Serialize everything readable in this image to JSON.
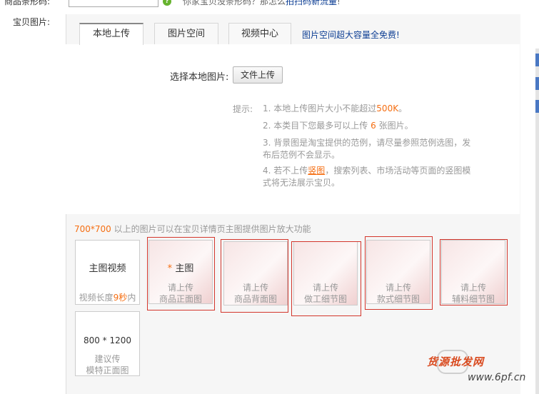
{
  "barcode": {
    "label": "商品条形码:",
    "hint_prefix": "你家宝贝没条形码？那怎么",
    "hint_link": "拍扫码新流量",
    "hint_suffix": "!"
  },
  "pictures_label": "宝贝图片:",
  "tabs": [
    {
      "label": "本地上传",
      "active": true
    },
    {
      "label": "图片空间",
      "active": false
    },
    {
      "label": "视频中心",
      "active": false
    }
  ],
  "tab_promo": "图片空间超大容量全免费!",
  "upload": {
    "choose_label": "选择本地图片:",
    "file_button": "文件上传"
  },
  "tips": {
    "label": "提示:",
    "items": [
      {
        "num": "1.",
        "pre": "本地上传图片大小不能超过",
        "hl": "500K",
        "post": "。"
      },
      {
        "num": "2.",
        "pre": "本类目下您最多可以上传 ",
        "hl": "6",
        "post": " 张图片。"
      },
      {
        "num": "3.",
        "text": "背景图是淘宝提供的范例，请尽量参照范例选图，发布后范例不会显示。"
      },
      {
        "num": "4.",
        "pre": "若不上传",
        "hl": "竖图",
        "post": "，搜索列表、市场活动等页面的竖图模式将无法展示宝贝。"
      }
    ]
  },
  "size_note": {
    "hl": "700*700",
    "text": " 以上的图片可以在宝贝详情页主图提供图片放大功能"
  },
  "slots": {
    "video": {
      "title": "主图视频",
      "sub_pre": "视频长度",
      "sub_hl": "9秒",
      "sub_post": "内"
    },
    "main": {
      "star": "*",
      "title": "主图",
      "line1": "请上传",
      "line2": "商品正面图"
    },
    "back": {
      "line1": "请上传",
      "line2": "商品背面图"
    },
    "craft": {
      "line1": "请上传",
      "line2": "做工细节图"
    },
    "style": {
      "line1": "请上传",
      "line2": "款式细节图"
    },
    "accessory": {
      "line1": "请上传",
      "line2": "辅料细节图"
    },
    "model": {
      "title": "800 * 1200",
      "line1": "建议传",
      "line2": "模特正面图"
    }
  },
  "watermark": {
    "brand": "货源批发网",
    "url": "www.6pf.cn"
  },
  "colors": {
    "accent": "#f56e12",
    "link": "#0e3f94",
    "frame": "#d3362c"
  }
}
